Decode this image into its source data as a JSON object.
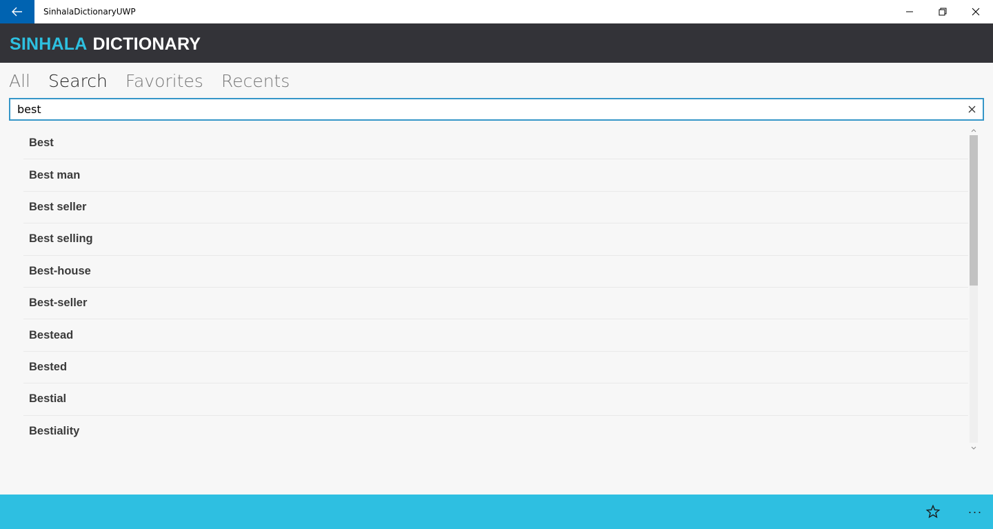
{
  "window": {
    "title": "SinhalaDictionaryUWP"
  },
  "header": {
    "logo_part1": "SINHALA",
    "logo_part2": "DICTIONARY"
  },
  "tabs": [
    {
      "label": "All",
      "active": false
    },
    {
      "label": "Search",
      "active": true
    },
    {
      "label": "Favorites",
      "active": false
    },
    {
      "label": "Recents",
      "active": false
    }
  ],
  "search": {
    "value": "best",
    "placeholder": ""
  },
  "results": [
    {
      "label": "Best"
    },
    {
      "label": "Best man"
    },
    {
      "label": "Best seller"
    },
    {
      "label": "Best selling"
    },
    {
      "label": "Best-house"
    },
    {
      "label": "Best-seller"
    },
    {
      "label": "Bestead"
    },
    {
      "label": "Bested"
    },
    {
      "label": "Bestial"
    },
    {
      "label": "Bestiality"
    }
  ],
  "appbar": {
    "more_label": "···"
  },
  "colors": {
    "titlebar_back": "#0063b1",
    "header_bg": "#333338",
    "logo_accent": "#2dc0e0",
    "search_border": "#3596c8",
    "appbar_bg": "#2ebfe1"
  },
  "icons": {
    "back": "arrow-left-icon",
    "minimize": "minimize-icon",
    "maximize": "restore-icon",
    "close": "close-icon",
    "clear": "clear-icon",
    "favorite": "star-icon",
    "more": "more-icon"
  }
}
